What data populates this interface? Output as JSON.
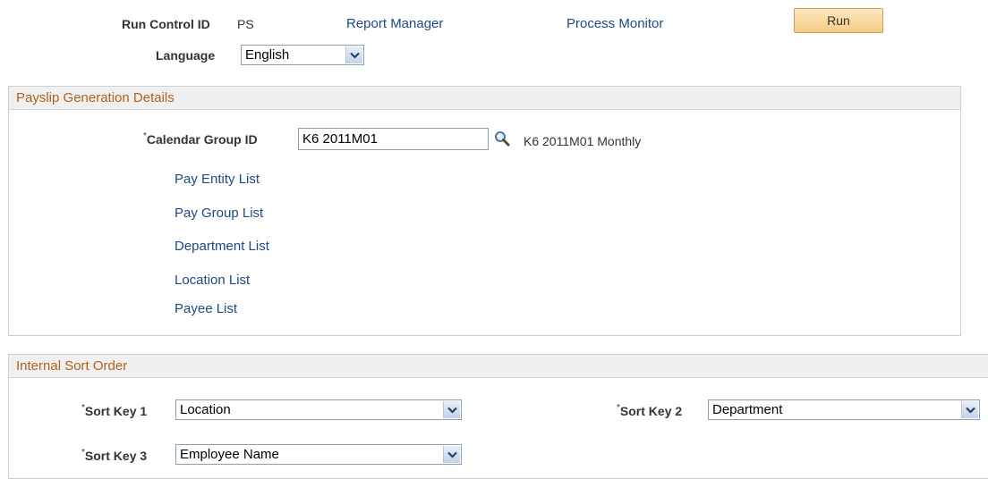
{
  "toolbar": {
    "run_control_label": "Run Control ID",
    "run_control_value": "PS",
    "report_manager_link": "Report Manager",
    "process_monitor_link": "Process Monitor",
    "run_label": "Run",
    "language_label": "Language",
    "language_value": "English"
  },
  "payslip": {
    "title": "Payslip Generation Details",
    "calendar_group_label": "Calendar Group ID",
    "calendar_group_value": "K6 2011M01",
    "calendar_group_desc": "K6 2011M01 Monthly",
    "lists": [
      "Pay Entity List",
      "Pay Group List",
      "Department List",
      "Location List",
      "Payee List"
    ]
  },
  "sort": {
    "title": "Internal Sort Order",
    "key1_label": "Sort Key 1",
    "key1_value": "Location",
    "key2_label": "Sort Key 2",
    "key2_value": "Department",
    "key3_label": "Sort Key 3",
    "key3_value": "Employee Name"
  },
  "required_marker": "*",
  "colors": {
    "section_title": "#b0601e",
    "link": "#1c4a82",
    "run_button": "#f6cc85"
  },
  "icons": {
    "lookup": "magnifier-icon",
    "dropdown": "chevron-down-icon"
  }
}
